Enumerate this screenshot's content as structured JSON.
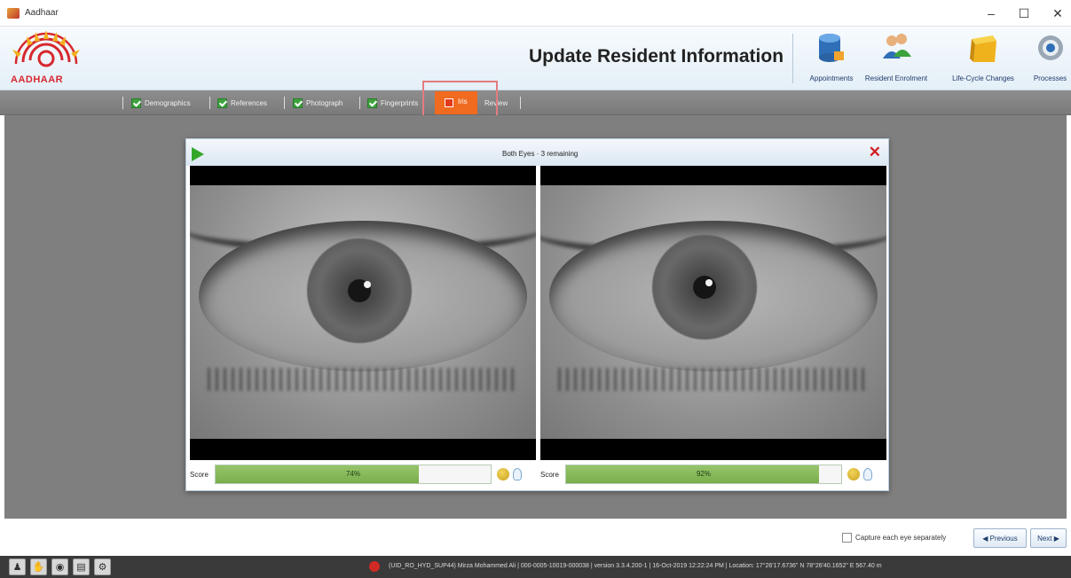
{
  "window": {
    "title": "Aadhaar",
    "controls": {
      "minimize": "–",
      "maximize": "☐",
      "close": "✕"
    }
  },
  "header": {
    "logo_text": "AADHAAR",
    "page_title": "Update Resident Information",
    "tools": [
      {
        "label": "Appointments",
        "icon": "database-icon"
      },
      {
        "label": "Resident Enrolment",
        "icon": "users-icon"
      },
      {
        "label": "Life-Cycle Changes",
        "icon": "box-icon"
      },
      {
        "label": "Processes",
        "icon": "gear-icon"
      }
    ]
  },
  "tabs": {
    "items": [
      {
        "label": "Demographics",
        "status": "complete"
      },
      {
        "label": "References",
        "status": "complete"
      },
      {
        "label": "Photograph",
        "status": "complete"
      },
      {
        "label": "Fingerprints",
        "status": "complete"
      }
    ],
    "active": {
      "label": "Iris",
      "status": "active"
    },
    "next": {
      "label": "Review"
    }
  },
  "dialog": {
    "status": "Both Eyes · 3 remaining",
    "close": "✕"
  },
  "eyes": {
    "left": {
      "score_label": "Score",
      "score_percent": 74,
      "score_text": "74%"
    },
    "right": {
      "score_label": "Score",
      "score_percent": 92,
      "score_text": "92%"
    }
  },
  "actions": {
    "capture_separately": "Capture each eye separately",
    "capture_checked": false,
    "previous": "◀ Previous",
    "next": "Next ▶"
  },
  "status_bar": {
    "text": "(UID_RO_HYD_SUP44) Mirza Mohammed Ali | 000-0005-10019-000038 | version 3.3.4.200-1 | 16-Oct-2019 12:22:24 PM | Location: 17°26'17.6736\" N 78°26'40.1652\" E 567.40 m"
  },
  "colors": {
    "tab_active": "#f06a1f",
    "check_green": "#3da33d",
    "score_fill": "#86b85a",
    "close_red": "#d21f26",
    "highlight": "#e47b80"
  }
}
